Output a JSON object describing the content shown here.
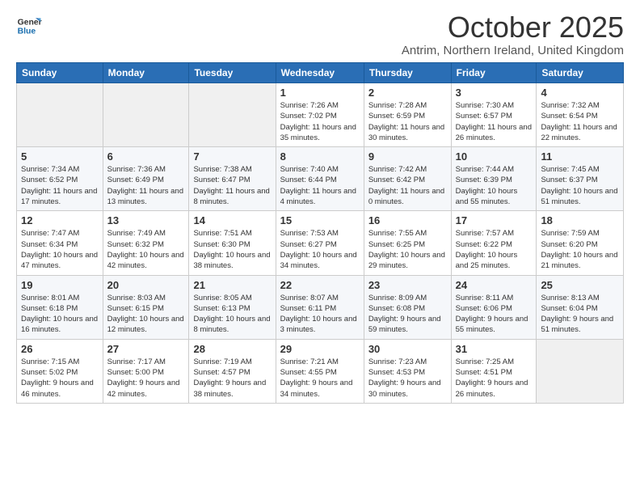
{
  "header": {
    "month_title": "October 2025",
    "location": "Antrim, Northern Ireland, United Kingdom",
    "logo_line1": "General",
    "logo_line2": "Blue"
  },
  "weekdays": [
    "Sunday",
    "Monday",
    "Tuesday",
    "Wednesday",
    "Thursday",
    "Friday",
    "Saturday"
  ],
  "weeks": [
    [
      {
        "day": "",
        "info": ""
      },
      {
        "day": "",
        "info": ""
      },
      {
        "day": "",
        "info": ""
      },
      {
        "day": "1",
        "info": "Sunrise: 7:26 AM\nSunset: 7:02 PM\nDaylight: 11 hours\nand 35 minutes."
      },
      {
        "day": "2",
        "info": "Sunrise: 7:28 AM\nSunset: 6:59 PM\nDaylight: 11 hours\nand 30 minutes."
      },
      {
        "day": "3",
        "info": "Sunrise: 7:30 AM\nSunset: 6:57 PM\nDaylight: 11 hours\nand 26 minutes."
      },
      {
        "day": "4",
        "info": "Sunrise: 7:32 AM\nSunset: 6:54 PM\nDaylight: 11 hours\nand 22 minutes."
      }
    ],
    [
      {
        "day": "5",
        "info": "Sunrise: 7:34 AM\nSunset: 6:52 PM\nDaylight: 11 hours\nand 17 minutes."
      },
      {
        "day": "6",
        "info": "Sunrise: 7:36 AM\nSunset: 6:49 PM\nDaylight: 11 hours\nand 13 minutes."
      },
      {
        "day": "7",
        "info": "Sunrise: 7:38 AM\nSunset: 6:47 PM\nDaylight: 11 hours\nand 8 minutes."
      },
      {
        "day": "8",
        "info": "Sunrise: 7:40 AM\nSunset: 6:44 PM\nDaylight: 11 hours\nand 4 minutes."
      },
      {
        "day": "9",
        "info": "Sunrise: 7:42 AM\nSunset: 6:42 PM\nDaylight: 11 hours\nand 0 minutes."
      },
      {
        "day": "10",
        "info": "Sunrise: 7:44 AM\nSunset: 6:39 PM\nDaylight: 10 hours\nand 55 minutes."
      },
      {
        "day": "11",
        "info": "Sunrise: 7:45 AM\nSunset: 6:37 PM\nDaylight: 10 hours\nand 51 minutes."
      }
    ],
    [
      {
        "day": "12",
        "info": "Sunrise: 7:47 AM\nSunset: 6:34 PM\nDaylight: 10 hours\nand 47 minutes."
      },
      {
        "day": "13",
        "info": "Sunrise: 7:49 AM\nSunset: 6:32 PM\nDaylight: 10 hours\nand 42 minutes."
      },
      {
        "day": "14",
        "info": "Sunrise: 7:51 AM\nSunset: 6:30 PM\nDaylight: 10 hours\nand 38 minutes."
      },
      {
        "day": "15",
        "info": "Sunrise: 7:53 AM\nSunset: 6:27 PM\nDaylight: 10 hours\nand 34 minutes."
      },
      {
        "day": "16",
        "info": "Sunrise: 7:55 AM\nSunset: 6:25 PM\nDaylight: 10 hours\nand 29 minutes."
      },
      {
        "day": "17",
        "info": "Sunrise: 7:57 AM\nSunset: 6:22 PM\nDaylight: 10 hours\nand 25 minutes."
      },
      {
        "day": "18",
        "info": "Sunrise: 7:59 AM\nSunset: 6:20 PM\nDaylight: 10 hours\nand 21 minutes."
      }
    ],
    [
      {
        "day": "19",
        "info": "Sunrise: 8:01 AM\nSunset: 6:18 PM\nDaylight: 10 hours\nand 16 minutes."
      },
      {
        "day": "20",
        "info": "Sunrise: 8:03 AM\nSunset: 6:15 PM\nDaylight: 10 hours\nand 12 minutes."
      },
      {
        "day": "21",
        "info": "Sunrise: 8:05 AM\nSunset: 6:13 PM\nDaylight: 10 hours\nand 8 minutes."
      },
      {
        "day": "22",
        "info": "Sunrise: 8:07 AM\nSunset: 6:11 PM\nDaylight: 10 hours\nand 3 minutes."
      },
      {
        "day": "23",
        "info": "Sunrise: 8:09 AM\nSunset: 6:08 PM\nDaylight: 9 hours\nand 59 minutes."
      },
      {
        "day": "24",
        "info": "Sunrise: 8:11 AM\nSunset: 6:06 PM\nDaylight: 9 hours\nand 55 minutes."
      },
      {
        "day": "25",
        "info": "Sunrise: 8:13 AM\nSunset: 6:04 PM\nDaylight: 9 hours\nand 51 minutes."
      }
    ],
    [
      {
        "day": "26",
        "info": "Sunrise: 7:15 AM\nSunset: 5:02 PM\nDaylight: 9 hours\nand 46 minutes."
      },
      {
        "day": "27",
        "info": "Sunrise: 7:17 AM\nSunset: 5:00 PM\nDaylight: 9 hours\nand 42 minutes."
      },
      {
        "day": "28",
        "info": "Sunrise: 7:19 AM\nSunset: 4:57 PM\nDaylight: 9 hours\nand 38 minutes."
      },
      {
        "day": "29",
        "info": "Sunrise: 7:21 AM\nSunset: 4:55 PM\nDaylight: 9 hours\nand 34 minutes."
      },
      {
        "day": "30",
        "info": "Sunrise: 7:23 AM\nSunset: 4:53 PM\nDaylight: 9 hours\nand 30 minutes."
      },
      {
        "day": "31",
        "info": "Sunrise: 7:25 AM\nSunset: 4:51 PM\nDaylight: 9 hours\nand 26 minutes."
      },
      {
        "day": "",
        "info": ""
      }
    ]
  ]
}
